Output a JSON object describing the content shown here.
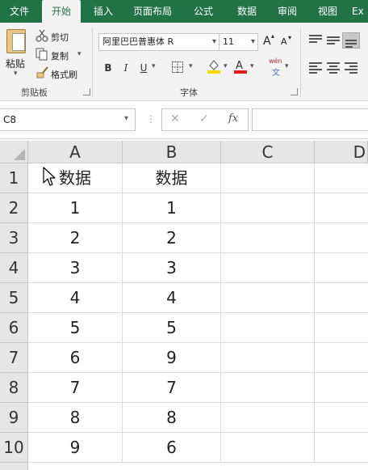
{
  "ribbon_tabs": [
    {
      "label": "文件"
    },
    {
      "label": "开始"
    },
    {
      "label": "插入"
    },
    {
      "label": "页面布局"
    },
    {
      "label": "公式"
    },
    {
      "label": "数据"
    },
    {
      "label": "审阅"
    },
    {
      "label": "视图"
    },
    {
      "label": "Ex"
    }
  ],
  "active_tab": "开始",
  "clipboard": {
    "paste_label": "粘贴",
    "cut_label": "剪切",
    "copy_label": "复制",
    "format_painter_label": "格式刷",
    "group_label": "剪贴板"
  },
  "font": {
    "font_name": "阿里巴巴普惠体 R",
    "font_size": "11",
    "grow_label": "A",
    "shrink_label": "A",
    "bold_label": "B",
    "italic_label": "I",
    "underline_label": "U",
    "phonetic_top": "wén",
    "phonetic_bottom": "文",
    "group_label": "字体"
  },
  "formula_bar": {
    "name_box": "C8",
    "cancel_symbol": "✕",
    "enter_symbol": "✓",
    "fx_symbol": "fx",
    "formula": ""
  },
  "sheet": {
    "columns": [
      "A",
      "B",
      "C",
      "D"
    ],
    "rows": [
      {
        "row": "1",
        "a": "数据",
        "b": "数据"
      },
      {
        "row": "2",
        "a": "1",
        "b": "1"
      },
      {
        "row": "3",
        "a": "2",
        "b": "2"
      },
      {
        "row": "4",
        "a": "3",
        "b": "3"
      },
      {
        "row": "5",
        "a": "4",
        "b": "4"
      },
      {
        "row": "6",
        "a": "5",
        "b": "5"
      },
      {
        "row": "7",
        "a": "6",
        "b": "9"
      },
      {
        "row": "8",
        "a": "7",
        "b": "7"
      },
      {
        "row": "9",
        "a": "8",
        "b": "8"
      },
      {
        "row": "10",
        "a": "9",
        "b": "6"
      }
    ]
  },
  "colors": {
    "accent": "#217346",
    "ribbon_bg": "#f3f3f3",
    "header_bg": "#e6e6e6",
    "fill_swatch": "#ffd800",
    "font_swatch": "#e01b1b"
  },
  "icons": [
    "scissors-icon",
    "copy-icon",
    "format-painter-icon",
    "paste-icon",
    "borders-icon",
    "fill-color-icon",
    "font-color-icon",
    "phonetic-icon",
    "align-icons",
    "mouse-cursor-icon"
  ]
}
